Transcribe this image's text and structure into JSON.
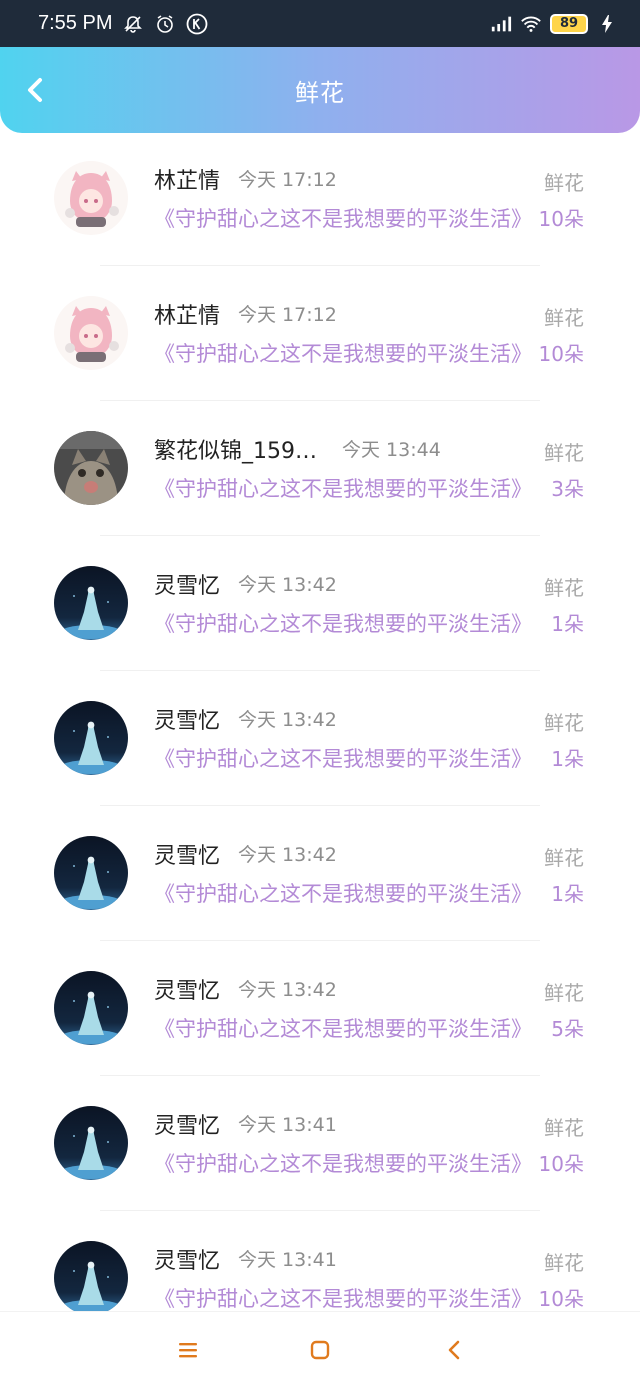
{
  "status_bar": {
    "time": "7:55 PM",
    "battery": "89",
    "icons": [
      "bell-off-icon",
      "alarm-icon",
      "k-icon",
      "signal-icon",
      "wifi-icon",
      "charging-icon"
    ]
  },
  "header": {
    "title": "鲜花",
    "back_icon": "chevron-left-icon",
    "gradient": [
      "#50d3ef",
      "#b998e6"
    ]
  },
  "colors": {
    "accent": "#b38ad6",
    "muted": "#8d8d8d"
  },
  "list": [
    {
      "name": "林芷情",
      "time": "今天 17:12",
      "book": "《守护甜心之这不是我想要的平淡生活》",
      "label": "鲜花",
      "count": "10朵",
      "avatar": "anime-girl"
    },
    {
      "name": "林芷情",
      "time": "今天 17:12",
      "book": "《守护甜心之这不是我想要的平淡生活》",
      "label": "鲜花",
      "count": "10朵",
      "avatar": "anime-girl"
    },
    {
      "name": "繁花似锦_1592...",
      "time": "今天 13:44",
      "book": "《守护甜心之这不是我想要的平淡生活》",
      "label": "鲜花",
      "count": "3朵",
      "avatar": "cat"
    },
    {
      "name": "灵雪忆",
      "time": "今天 13:42",
      "book": "《守护甜心之这不是我想要的平淡生活》",
      "label": "鲜花",
      "count": "1朵",
      "avatar": "night-figure"
    },
    {
      "name": "灵雪忆",
      "time": "今天 13:42",
      "book": "《守护甜心之这不是我想要的平淡生活》",
      "label": "鲜花",
      "count": "1朵",
      "avatar": "night-figure"
    },
    {
      "name": "灵雪忆",
      "time": "今天 13:42",
      "book": "《守护甜心之这不是我想要的平淡生活》",
      "label": "鲜花",
      "count": "1朵",
      "avatar": "night-figure"
    },
    {
      "name": "灵雪忆",
      "time": "今天 13:42",
      "book": "《守护甜心之这不是我想要的平淡生活》",
      "label": "鲜花",
      "count": "5朵",
      "avatar": "night-figure"
    },
    {
      "name": "灵雪忆",
      "time": "今天 13:41",
      "book": "《守护甜心之这不是我想要的平淡生活》",
      "label": "鲜花",
      "count": "10朵",
      "avatar": "night-figure"
    },
    {
      "name": "灵雪忆",
      "time": "今天 13:41",
      "book": "《守护甜心之这不是我想要的平淡生活》",
      "label": "鲜花",
      "count": "10朵",
      "avatar": "night-figure"
    }
  ],
  "nav_bar": {
    "icons": [
      "menu-icon",
      "home-square-icon",
      "back-triangle-icon"
    ]
  }
}
